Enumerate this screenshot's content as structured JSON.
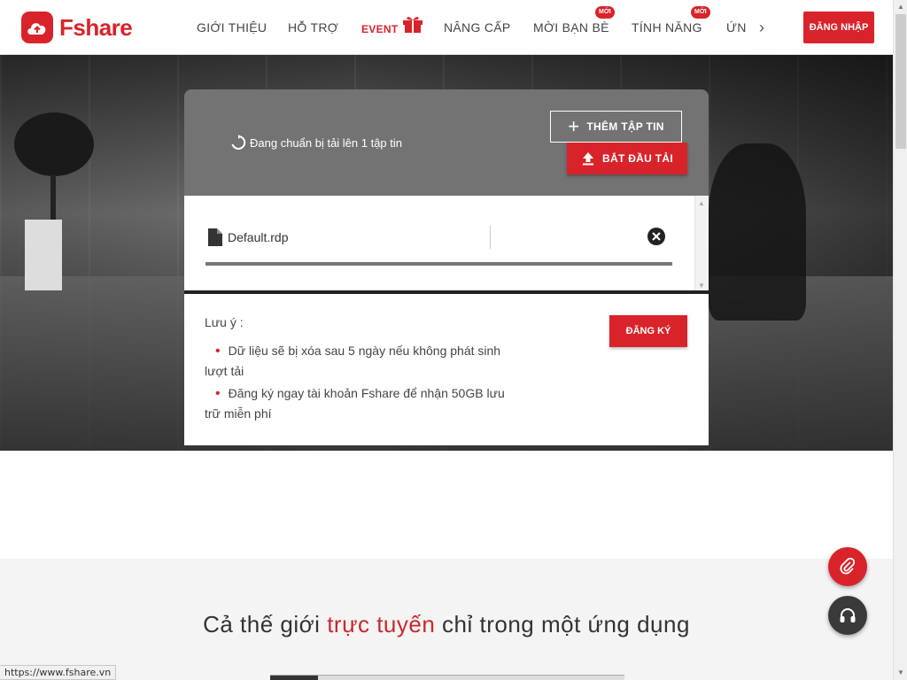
{
  "brand": {
    "name": "Fshare",
    "accent_color": "#d9232a"
  },
  "nav": {
    "items": [
      {
        "label": "GIỚI THIỆU"
      },
      {
        "label": "HỖ TRỢ"
      },
      {
        "label": "EVENT"
      },
      {
        "label": "NÂNG CẤP"
      },
      {
        "label": "MỜI BẠN BÈ",
        "badge": "MỚI"
      },
      {
        "label": "TÍNH NĂNG",
        "badge": "MỚI"
      },
      {
        "label": "ỨN"
      }
    ],
    "login_label": "ĐĂNG NHẬP"
  },
  "upload": {
    "status_text": "Đang chuẩn bị tải lên 1 tập tin",
    "add_file_label": "THÊM TẬP TIN",
    "start_label": "BẮT ĐẦU TẢI",
    "file": {
      "name": "Default.rdp"
    }
  },
  "note": {
    "title": "Lưu ý :",
    "items": [
      "Dữ liệu sẽ bị xóa sau 5 ngày nếu không phát sinh lượt tải",
      "Đăng ký ngay tài khoản Fshare để nhận 50GB lưu trữ miễn phí"
    ],
    "register_label": "ĐĂNG KÝ"
  },
  "tagline": {
    "prefix": "Cả thế giới ",
    "accent": "trực tuyến",
    "suffix": " chỉ trong một ứng dụng"
  },
  "status_bar": {
    "url": "https://www.fshare.vn"
  }
}
